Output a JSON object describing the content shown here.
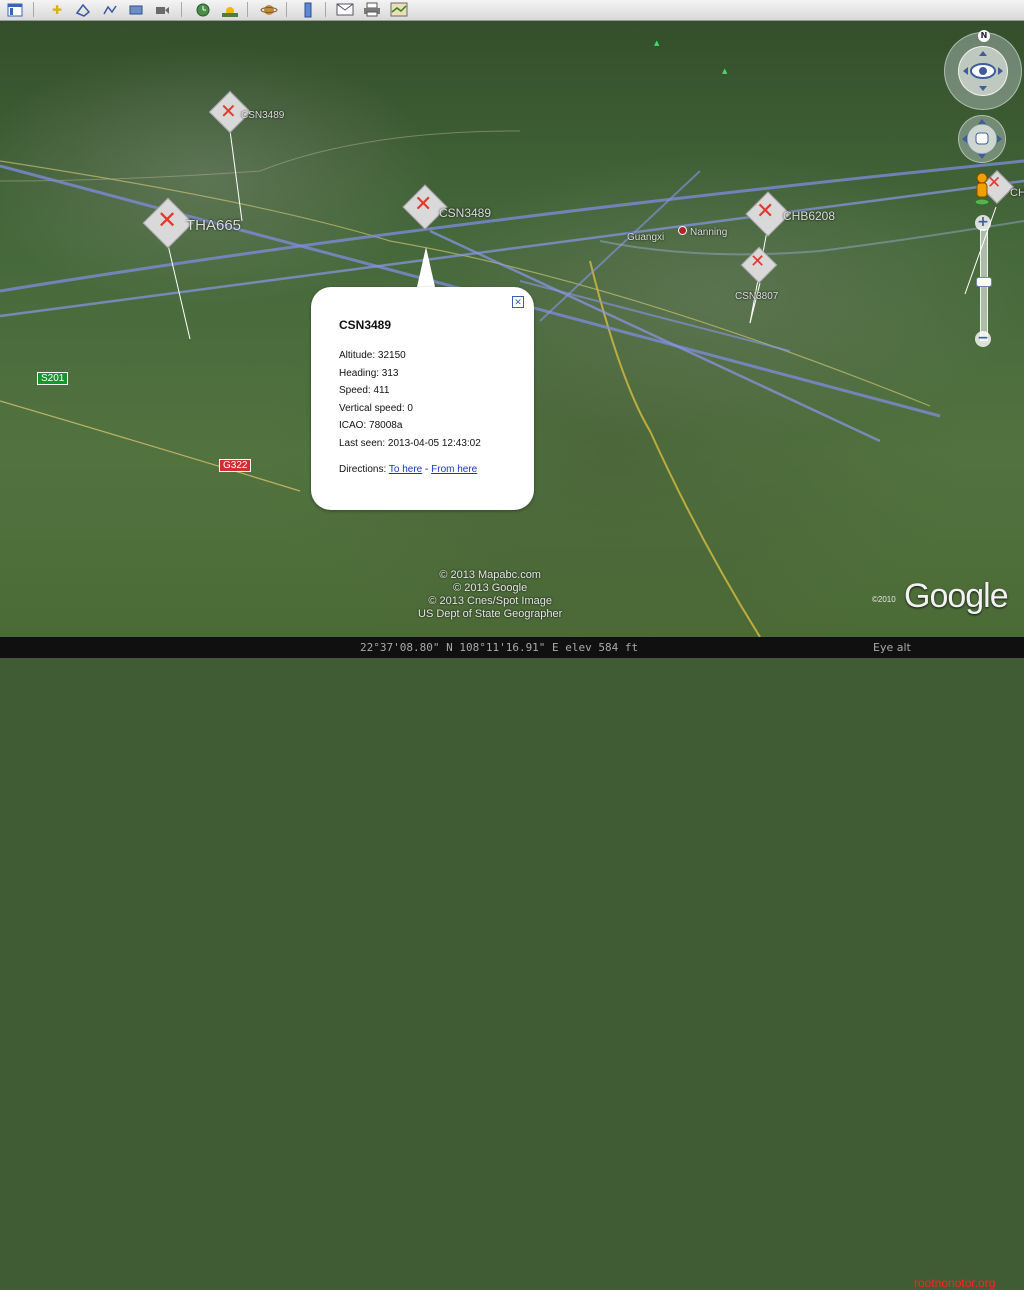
{
  "toolbar": {
    "buttons": [
      {
        "name": "sidebar-toggle-icon"
      },
      {
        "name": "placemark-icon"
      },
      {
        "name": "polygon-icon"
      },
      {
        "name": "path-icon"
      },
      {
        "name": "image-overlay-icon"
      },
      {
        "name": "record-tour-icon"
      },
      {
        "name": "history-imagery-icon"
      },
      {
        "name": "sunlight-icon"
      },
      {
        "name": "planet-switch-icon"
      },
      {
        "name": "ruler-icon"
      },
      {
        "name": "email-icon"
      },
      {
        "name": "print-icon"
      },
      {
        "name": "view-in-maps-icon"
      }
    ]
  },
  "map": {
    "labels": {
      "csn3489_top": "CSN3489",
      "tha665": "THA665",
      "csn3489_mid": "CSN3489",
      "chb6208": "CHB6208",
      "csn3807": "CSN3807",
      "ch_partial": "CH",
      "guangxi": "Guangxi",
      "nanning": "Nanning"
    },
    "road_labels": {
      "s201": "S201",
      "g322": "G322"
    },
    "copyright_lines": [
      "© 2013 Mapabc.com",
      "© 2013 Google",
      "© 2013 Cnes/Spot Image",
      "US Dept of State Geographer"
    ],
    "brand": "Google",
    "brand_year": "©2010"
  },
  "popup": {
    "title": "CSN3489",
    "lines": [
      "Altitude: 32150",
      "Heading: 313",
      "Speed: 411",
      "Vertical speed: 0",
      "ICAO: 78008a",
      "Last seen: 2013-04-05 12:43:02"
    ],
    "directions_label": "Directions:",
    "to_here": "To here",
    "separator": "-",
    "from_here": "From here"
  },
  "status_bar": {
    "coords": "22°37'08.80\" N  108°11'16.91\" E  elev  584 ft",
    "eye_alt": "Eye alt",
    "watermark": "rootnonotor.org"
  }
}
